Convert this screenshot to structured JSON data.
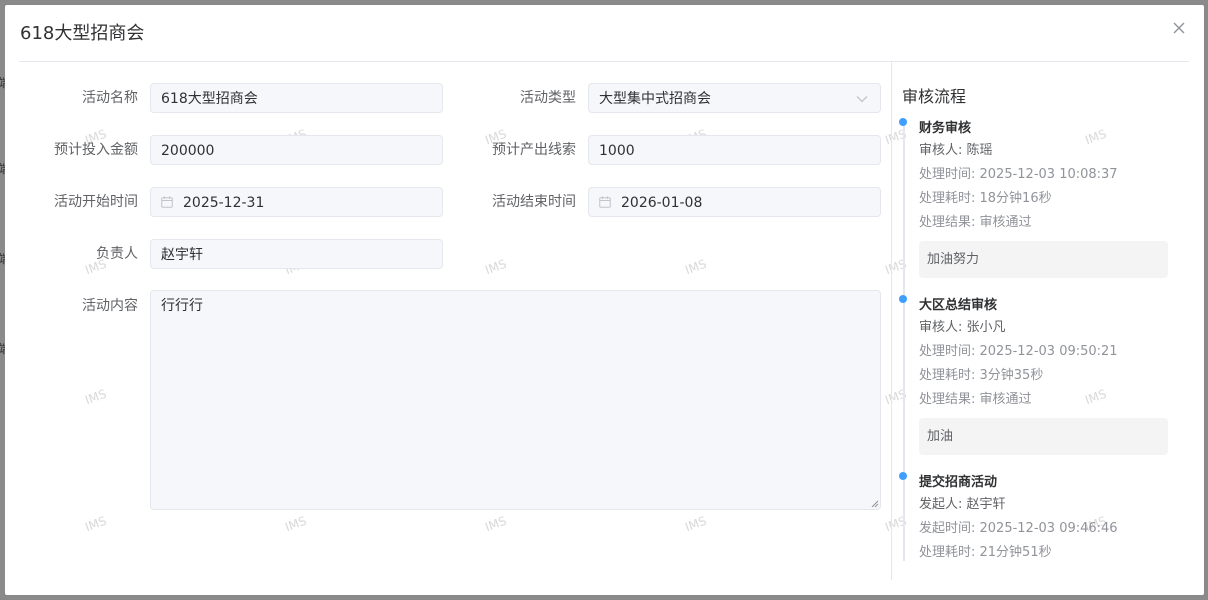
{
  "dialog": {
    "title": "618大型招商会",
    "watermark": "IMS"
  },
  "backdrop": {
    "fragments": [
      "端",
      "端",
      "端",
      "端"
    ]
  },
  "form": {
    "activity_name": {
      "label": "活动名称",
      "value": "618大型招商会"
    },
    "activity_type": {
      "label": "活动类型",
      "value": "大型集中式招商会"
    },
    "budget": {
      "label": "预计投入金额",
      "value": "200000"
    },
    "expected_leads": {
      "label": "预计产出线索",
      "value": "1000"
    },
    "start_date": {
      "label": "活动开始时间",
      "value": "2025-12-31"
    },
    "end_date": {
      "label": "活动结束时间",
      "value": "2026-01-08"
    },
    "owner": {
      "label": "负责人",
      "value": "赵宇轩"
    },
    "content": {
      "label": "活动内容",
      "value": "行行行"
    }
  },
  "approval": {
    "title": "审核流程",
    "steps": [
      {
        "name": "财务审核",
        "person": "审核人: 陈瑶",
        "time": "处理时间: 2025-12-03 10:08:37",
        "duration": "处理耗时: 18分钟16秒",
        "result": "处理结果: 审核通过",
        "comment": "加油努力"
      },
      {
        "name": "大区总结审核",
        "person": "审核人: 张小凡",
        "time": "处理时间: 2025-12-03 09:50:21",
        "duration": "处理耗时: 3分钟35秒",
        "result": "处理结果: 审核通过",
        "comment": "加油"
      },
      {
        "name": "提交招商活动",
        "person": "发起人: 赵宇轩",
        "time": "发起时间: 2025-12-03 09:46:46",
        "duration": "处理耗时: 21分钟51秒"
      }
    ]
  },
  "colors": {
    "accent": "#409eff",
    "field_bg": "#f5f7fa",
    "border": "#e4e7ed"
  }
}
